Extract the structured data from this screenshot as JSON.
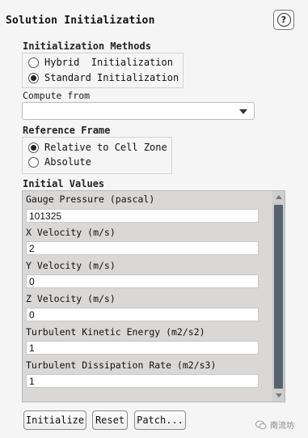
{
  "title": "Solution Initialization",
  "help_icon": "help-question-icon",
  "init_methods": {
    "label": "Initialization Methods",
    "options": [
      {
        "label": "Hybrid  Initialization",
        "checked": false
      },
      {
        "label": "Standard Initialization",
        "checked": true
      }
    ]
  },
  "compute_from": {
    "label": "Compute from",
    "value": ""
  },
  "reference_frame": {
    "label": "Reference Frame",
    "options": [
      {
        "label": "Relative to Cell Zone",
        "checked": true
      },
      {
        "label": "Absolute",
        "checked": false
      }
    ]
  },
  "initial_values": {
    "label": "Initial Values",
    "fields": [
      {
        "label": "Gauge Pressure (pascal)",
        "value": "101325"
      },
      {
        "label": "X Velocity (m/s)",
        "value": "2"
      },
      {
        "label": "Y Velocity (m/s)",
        "value": "0"
      },
      {
        "label": "Z Velocity (m/s)",
        "value": "0"
      },
      {
        "label": "Turbulent Kinetic Energy (m2/s2)",
        "value": "1"
      },
      {
        "label": "Turbulent Dissipation Rate (m2/s3)",
        "value": "1"
      }
    ]
  },
  "buttons": {
    "initialize": "Initialize",
    "reset": "Reset",
    "patch": "Patch..."
  },
  "watermark": {
    "text": "南流坊",
    "icon": "wechat-icon"
  }
}
